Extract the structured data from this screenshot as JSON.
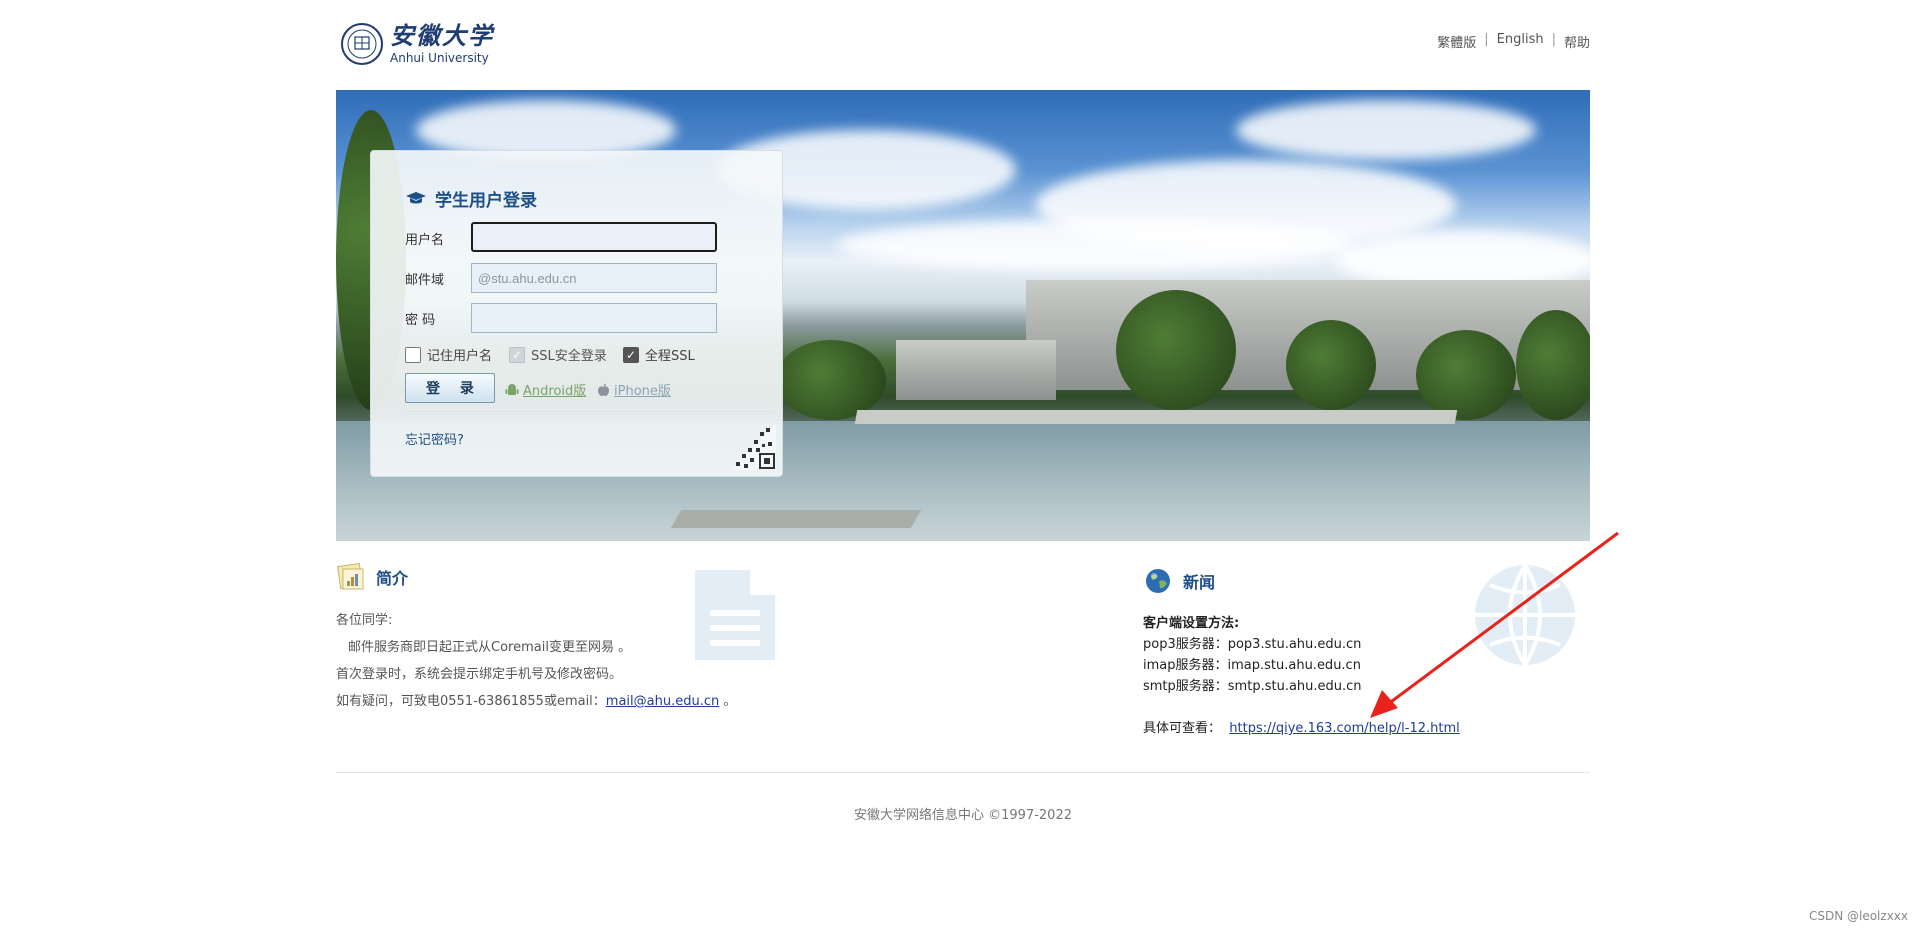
{
  "header": {
    "logo_cn": "安徽大学",
    "logo_en": "Anhui University",
    "links": [
      "繁體版",
      "English",
      "帮助"
    ]
  },
  "login": {
    "title": "学生用户登录",
    "username_label": "用户名",
    "username_value": "",
    "domain_label": "邮件域",
    "domain_placeholder": "@stu.ahu.edu.cn",
    "password_label": "密 码",
    "remember_label": "记住用户名",
    "ssl_label": "SSL安全登录",
    "full_ssl_label": "全程SSL",
    "login_button": "登 录",
    "android_label": "Android版",
    "iphone_label": "iPhone版",
    "forgot_label": "忘记密码?"
  },
  "intro": {
    "title": "简介",
    "lines": [
      "各位同学:",
      "邮件服务商即日起正式从Coremail变更至网易 。",
      "首次登录时，系统会提示绑定手机号及修改密码。"
    ],
    "contact_prefix": "如有疑问，可致电0551-63861855或email：",
    "contact_email": "mail@ahu.edu.cn",
    "contact_suffix": " 。"
  },
  "news": {
    "title": "新闻",
    "heading": "客户端设置方法:",
    "lines": [
      "pop3服务器：pop3.stu.ahu.edu.cn",
      "imap服务器：imap.stu.ahu.edu.cn",
      "smtp服务器：smtp.stu.ahu.edu.cn"
    ],
    "help_prefix": "具体可查看：",
    "help_link": "https://qiye.163.com/help/l-12.html"
  },
  "footer": {
    "copyright": "安徽大学网络信息中心 ©1997-2022",
    "watermark": "CSDN @leolzxxx"
  },
  "colors": {
    "accent": "#1f4f87",
    "annotation_arrow": "#e8231b"
  }
}
